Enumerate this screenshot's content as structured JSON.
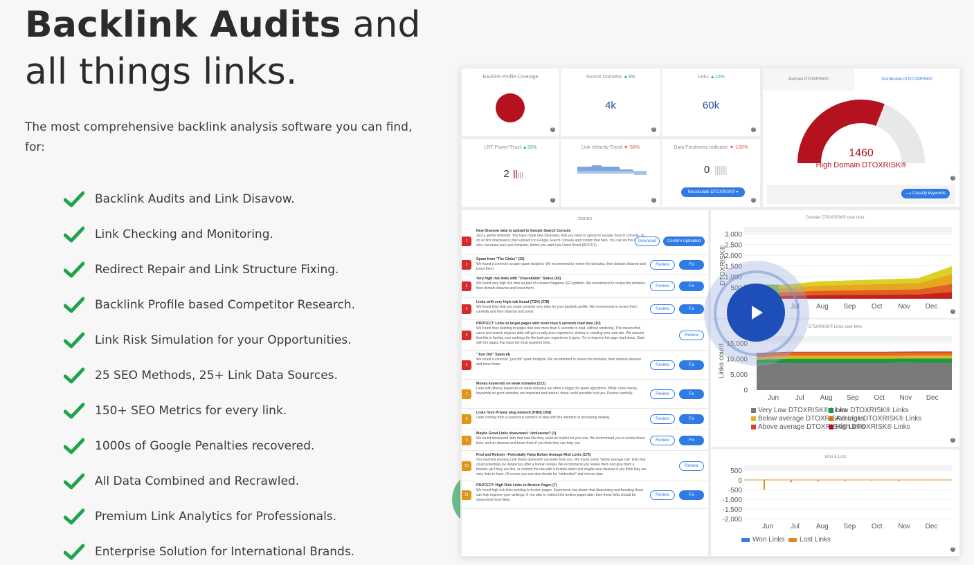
{
  "hero": {
    "title_bold": "Backlink Audits",
    "title_rest": " and",
    "title_line2": "all things links.",
    "subtitle": "The most comprehensive backlink analysis software you can find, for:"
  },
  "features": [
    "Backlink Audits and Link Disavow.",
    "Link Checking and Monitoring.",
    "Redirect Repair and Link Structure Fixing.",
    "Backlink Profile based Competitor Research.",
    "Link Risk Simulation for your Opportunities.",
    "25 SEO Methods, 25+ Link Data Sources.",
    "150+ SEO Metrics for every link.",
    "1000s of Google Penalties recovered.",
    "All Data Combined and Recrawled.",
    "Premium Link Analytics for Professionals.",
    "Enterprise Solution for International Brands."
  ],
  "colors": {
    "check": "#1ea54c",
    "accent": "#2f7ae5",
    "risk_red": "#b3121e",
    "play": "#1e4fb8"
  },
  "dashboard": {
    "coverage": {
      "title": "Backlink Profile Coverage"
    },
    "source_domains": {
      "title": "Source Domains",
      "delta": "3%",
      "value": "4k"
    },
    "links": {
      "title": "Links",
      "delta": "12%",
      "value": "60k"
    },
    "lrt_power": {
      "title": "LRT Power*Trust",
      "delta": "33%",
      "value": "2"
    },
    "velocity": {
      "title": "Link Velocity Trend",
      "delta": "-56%"
    },
    "freshness": {
      "title": "Data Freshness Indicator",
      "delta": "-100%",
      "value": "0",
      "button": "Recalculate DTOXRISK®"
    },
    "risk": {
      "tab1": "Domain DTOXRISK®",
      "tab2": "Distribution of DTOXRISK®",
      "value": "1460",
      "label": "High Domain DTOXRISK®",
      "gauge_fraction": 0.62,
      "button": "Classify keywords"
    },
    "issues": {
      "title": "Issues",
      "items": [
        {
          "num": "1",
          "color": "#d62b2b",
          "title": "New Disavow data to upload to Google Search Console",
          "text": "Just a gentle reminder. You have made new Disavows, that you need to upload to Google Search Console. To do so first download it, then upload it to Google Search Console and confirm that here. You can do this later also, but make sure you complete, before you start Link Detox Boost (BOOST).",
          "btn1": "Download",
          "btn2": "Confirm Uploaded"
        },
        {
          "num": "2",
          "color": "#d62b2b",
          "title": "Spam from \"The Globe\" (32)",
          "text": "We found a common scraper spam footprint. We recommend to review the domains, then domain disavow and boost them.",
          "btn1": "Review",
          "btn2": "Fix"
        },
        {
          "num": "3",
          "color": "#d62b2b",
          "title": "Very high risk links with \"Unavailable\" Status (65)",
          "text": "We found very high risk links as part of a known Negative SEO pattern. We recommend to review the domains, then domain disavow and boost them.",
          "btn1": "Review",
          "btn2": "Fix"
        },
        {
          "num": "4",
          "color": "#d62b2b",
          "title": "Links with very high risk found (TOX) (378)",
          "text": "We found links that you could consider very risky for your backlink profile. We recommend to review them carefully and then disavow and boost.",
          "btn1": "Review",
          "btn2": "Fix"
        },
        {
          "num": "5",
          "color": "#d62b2b",
          "title": "PROTECT: Links to target pages with more than 5 seconds load time (10)",
          "text": "We found links pointing to pages that took more than 5 seconds to load, without rendering. This means that users and search engines alike will get a really poor experience visiting or crawling your web site. We assume that this is hurting your rankings for the bad user experience it gives. Try to improve the page load times. Start with the pages that have the most powerful links.",
          "btn1": "Review",
          "btn2": ""
        },
        {
          "num": "6",
          "color": "#d62b2b",
          "title": "\"Just Dot\" Spam (4)",
          "text": "We found a common \"just dot\" spam footprint. We recommend to review the domains, then domain disavow and boost them.",
          "btn1": "Review",
          "btn2": "Fix"
        },
        {
          "num": "7",
          "color": "#e0961a",
          "title": "Money keywords on weak domains (212)",
          "text": "Links with Money keywords on weak domains are often a trigger for spam algorithms. While a few money keywords on good websites are important and natural, those could possible hurt you. Review carefully.",
          "btn1": "Review",
          "btn2": "Fix"
        },
        {
          "num": "8",
          "color": "#e0961a",
          "title": "Links from Private blog network (PBN) (354)",
          "text": "Links coming from a suspicious network of sites with the intention of increasing ranking.",
          "btn1": "Review",
          "btn2": "Fix"
        },
        {
          "num": "9",
          "color": "#e0961a",
          "title": "Maybe Good Links disavowed. Undisavow? (1)",
          "text": "We found disavowed links that look like they could be helpful for you now. We recommend you to review those links, and un-disavow and boost them if you think they can help you.",
          "btn1": "Review",
          "btn2": "Fix"
        },
        {
          "num": "10",
          "color": "#e0961a",
          "title": "Find and Retrain - Potentially False Below Average Risk Links (175)",
          "text": "Our machine learning Link Detox Genesis® can learn from you. We found some \"below average risk\" links that could potentially be dangerous after a human review. We recommend you review them and give them a thumbs-up if they are fine, or confirm the risk with a thumbs-down and maybe also disavow if you think they are risky links to have. Of course you can also decide for \"undecided\" and choose later.",
          "btn1": "Review",
          "btn2": ""
        },
        {
          "num": "11",
          "color": "#e0961a",
          "title": "PROTECT: High Risk Links to Broken Pages (7)",
          "text": "We found high risk links pointing to broken pages. Experience has shown that disavowing and boosting those can help improve your rankings. If you plan to redirect the broken pages later, then these links should be disavowed most likely.",
          "btn1": "Review",
          "btn2": "Fix"
        }
      ]
    }
  },
  "chart_data": [
    {
      "type": "area",
      "title": "Domain DTOXRISK® over time",
      "ylabel": "DTOXRISK®",
      "categories": [
        "Jun",
        "Jul",
        "Aug",
        "Sep",
        "Oct",
        "Nov",
        "Dec"
      ],
      "yticks": [
        "3,000",
        "2,500",
        "2,000",
        "1,500",
        "1,000",
        "500"
      ],
      "ylim": [
        0,
        3000
      ],
      "values": [
        650,
        650,
        800,
        850,
        900,
        950,
        1500
      ]
    },
    {
      "type": "area",
      "title": "DTOXRISK® Links over time",
      "ylabel": "Links count",
      "categories": [
        "Jun",
        "Jul",
        "Aug",
        "Sep",
        "Oct",
        "Nov",
        "Dec"
      ],
      "yticks": [
        "15,000",
        "10,000",
        "5,000",
        "0"
      ],
      "ylim": [
        0,
        15000
      ],
      "series": [
        {
          "name": "Very Low DTOXRISK® Links",
          "color": "#7a7a7a",
          "values": [
            8500,
            8600,
            8600,
            8600,
            8600,
            8700,
            8700
          ]
        },
        {
          "name": "Low DTOXRISK® Links",
          "color": "#1a9a3e",
          "values": [
            1200,
            1400,
            1400,
            1400,
            1400,
            1400,
            1400
          ]
        },
        {
          "name": "Below average DTOXRISK® Links",
          "color": "#e8b020",
          "values": [
            800,
            900,
            900,
            900,
            900,
            900,
            900
          ]
        },
        {
          "name": "Average DTOXRISK® Links",
          "color": "#d9741c",
          "values": [
            900,
            900,
            900,
            900,
            900,
            900,
            900
          ]
        },
        {
          "name": "Above average DTOXRISK® Links",
          "color": "#e23b2b",
          "values": [
            300,
            300,
            300,
            300,
            300,
            300,
            300
          ]
        },
        {
          "name": "High DTOXRISK® Links",
          "color": "#a3151e",
          "values": [
            100,
            100,
            100,
            100,
            100,
            100,
            100
          ]
        }
      ]
    },
    {
      "type": "bar",
      "title": "Won & Lost",
      "categories": [
        "Jun",
        "Jul",
        "Aug",
        "Sep",
        "Oct",
        "Nov",
        "Dec"
      ],
      "yticks": [
        "500",
        "0",
        "-500",
        "-1,000",
        "-1,500",
        "-2,000"
      ],
      "ylim": [
        -2000,
        500
      ],
      "series": [
        {
          "name": "Won Links",
          "color": "#3a7be0",
          "values": [
            20,
            10,
            10,
            10,
            10,
            10,
            10
          ]
        },
        {
          "name": "Lost Links",
          "color": "#e08a1a",
          "values": [
            -500,
            -120,
            -80,
            -60,
            -40,
            -60,
            -30
          ]
        }
      ]
    }
  ]
}
